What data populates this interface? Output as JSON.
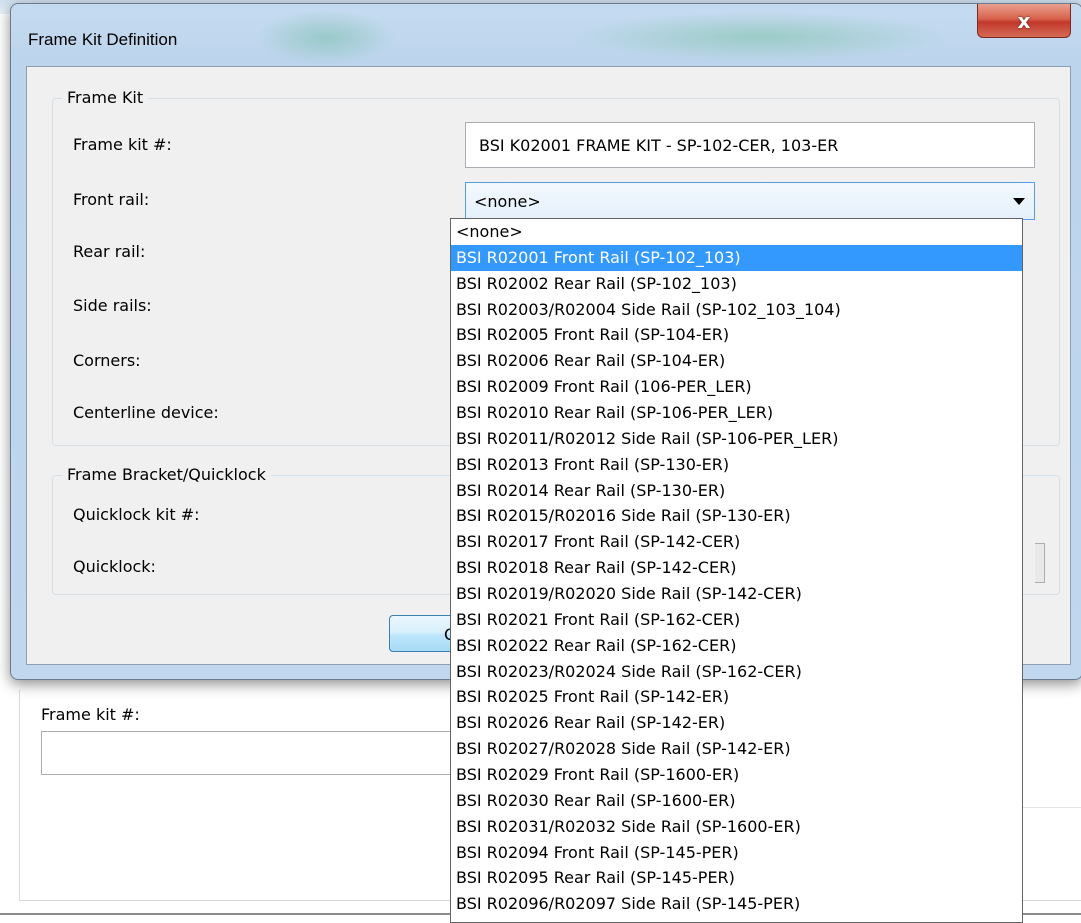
{
  "background_window": {
    "frame_kit_label": "Frame kit #:",
    "frame_kit_value": ""
  },
  "dialog": {
    "title": "Frame Kit Definition",
    "close_glyph": "x",
    "frame_kit_group": {
      "legend": "Frame Kit",
      "frame_kit_label": "Frame kit #:",
      "frame_kit_value": "BSI K02001 FRAME KIT - SP-102-CER, 103-ER",
      "front_rail_label": "Front rail:",
      "front_rail_value": "<none>",
      "rear_rail_label": "Rear rail:",
      "side_rails_label": "Side rails:",
      "corners_label": "Corners:",
      "centerline_label": "Centerline device:"
    },
    "quicklock_group": {
      "legend": "Frame Bracket/Quicklock",
      "kit_label": "Quicklock kit #:",
      "quicklock_label": "Quicklock:"
    },
    "ok_label": "OK"
  },
  "dropdown": {
    "selected_index": 1,
    "items": [
      "<none>",
      "BSI R02001 Front Rail (SP-102_103)",
      "BSI R02002 Rear Rail (SP-102_103)",
      "BSI R02003/R02004 Side Rail (SP-102_103_104)",
      "BSI R02005 Front Rail (SP-104-ER)",
      "BSI R02006 Rear Rail (SP-104-ER)",
      "BSI R02009 Front Rail (106-PER_LER)",
      "BSI R02010 Rear Rail (SP-106-PER_LER)",
      "BSI R02011/R02012 Side Rail (SP-106-PER_LER)",
      "BSI R02013 Front Rail (SP-130-ER)",
      "BSI R02014 Rear Rail (SP-130-ER)",
      "BSI R02015/R02016 Side Rail (SP-130-ER)",
      "BSI R02017 Front Rail (SP-142-CER)",
      "BSI R02018 Rear Rail (SP-142-CER)",
      "BSI R02019/R02020 Side Rail (SP-142-CER)",
      "BSI R02021 Front Rail (SP-162-CER)",
      "BSI R02022 Rear Rail (SP-162-CER)",
      "BSI R02023/R02024 Side Rail (SP-162-CER)",
      "BSI R02025 Front Rail (SP-142-ER)",
      "BSI R02026 Rear Rail (SP-142-ER)",
      "BSI R02027/R02028 Side Rail (SP-142-ER)",
      "BSI R02029 Front Rail (SP-1600-ER)",
      "BSI R02030 Rear Rail (SP-1600-ER)",
      "BSI R02031/R02032 Side Rail (SP-1600-ER)",
      "BSI R02094 Front Rail (SP-145-PER)",
      "BSI R02095 Rear Rail (SP-145-PER)",
      "BSI R02096/R02097 Side Rail (SP-145-PER)"
    ]
  },
  "colors": {
    "selection": "#3399ff",
    "close_button": "#c1392b",
    "dialog_frame": "#c0d7ee"
  }
}
